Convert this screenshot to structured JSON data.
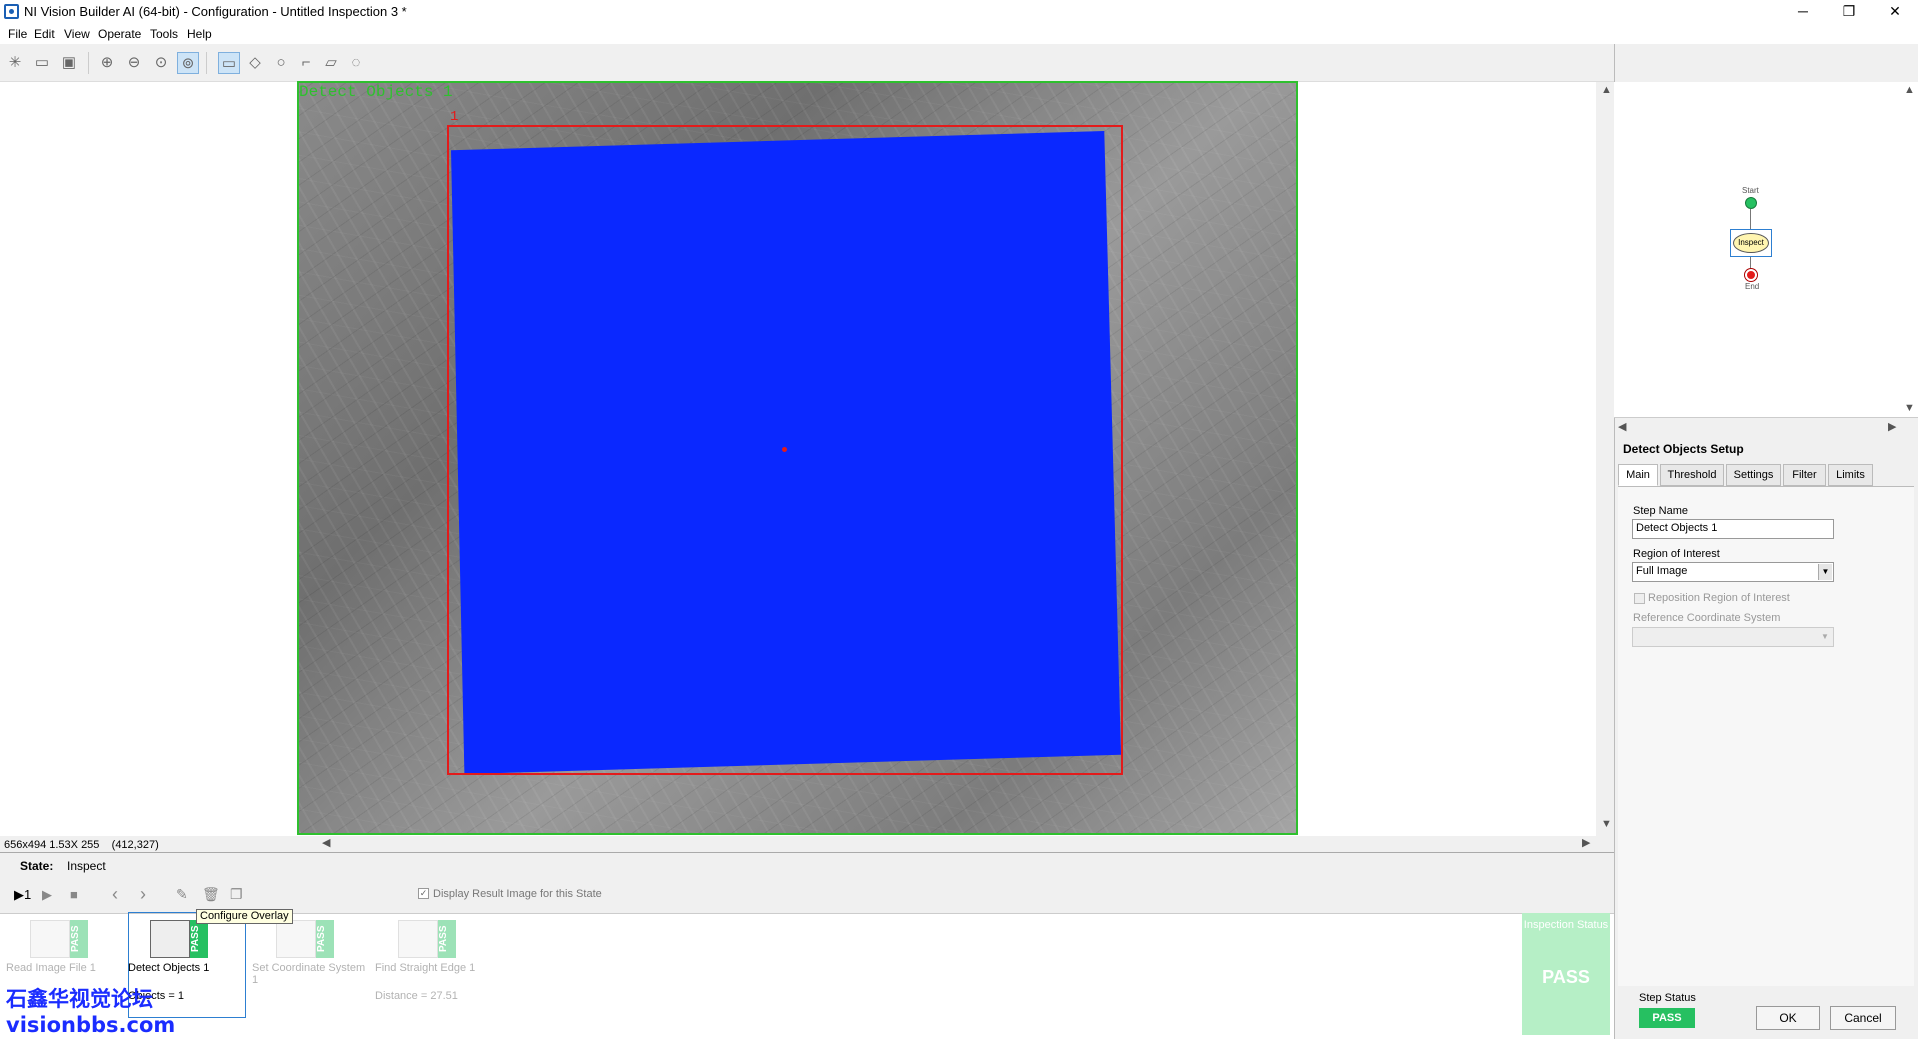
{
  "window": {
    "title": "NI Vision Builder AI (64-bit) - Configuration - Untitled Inspection 3 *",
    "minimize": "─",
    "restore": "❐",
    "close": "✕"
  },
  "menu": [
    "File",
    "Edit",
    "View",
    "Operate",
    "Tools",
    "Help"
  ],
  "toolbar": {
    "icons": [
      "new-icon",
      "open-icon",
      "save-icon",
      "zoom-in-icon",
      "zoom-out-icon",
      "zoom-fit-icon",
      "zoom-region-icon",
      "rect-roi-icon",
      "point-roi-icon",
      "circle-roi-icon",
      "polyline-roi-icon",
      "polygon-roi-icon",
      "freehand-roi-icon"
    ],
    "help": "?"
  },
  "image": {
    "overlay_label": "Detect Objects 1",
    "roi_number": "1",
    "info_size": "656x494 1.53X 255",
    "info_coords": "(412,327)"
  },
  "state": {
    "label": "State:",
    "value": "Inspect"
  },
  "steps_toolbar": {
    "run_once": "▶1",
    "run": "▶",
    "stop": "■",
    "prev": "‹",
    "next": "›",
    "display_result": "Display Result Image for this State"
  },
  "steps": [
    {
      "name": "Read Image File 1",
      "status": "PASS",
      "result": ""
    },
    {
      "name": "Detect Objects 1",
      "status": "PASS",
      "result": "Objects = 1"
    },
    {
      "name": "Set Coordinate System 1",
      "status": "PASS",
      "result": ""
    },
    {
      "name": "Find Straight Edge 1",
      "status": "PASS",
      "result": "Distance = 27.51"
    }
  ],
  "tooltip": "Configure Overlay",
  "inspection_status": {
    "title": "Inspection Status",
    "value": "PASS"
  },
  "watermark": {
    "line1": "石鑫华视觉论坛",
    "line2": "visionbbs.com"
  },
  "flowchart": {
    "start": "Start",
    "state": "Inspect",
    "end": "End"
  },
  "setup": {
    "title": "Detect Objects Setup",
    "tabs": [
      "Main",
      "Threshold",
      "Settings",
      "Filter",
      "Limits"
    ],
    "step_name_label": "Step Name",
    "step_name_value": "Detect Objects 1",
    "roi_label": "Region of Interest",
    "roi_value": "Full Image",
    "reposition_label": "Reposition Region of Interest",
    "ref_coord_label": "Reference Coordinate System",
    "ref_coord_value": "",
    "step_status_label": "Step Status",
    "step_status_value": "PASS",
    "ok": "OK",
    "cancel": "Cancel"
  },
  "colors": {
    "pass_green": "#26c061",
    "roi_red": "#e31b1b",
    "blob_blue": "#0a28ff",
    "overlay_green": "#2ec02e"
  }
}
